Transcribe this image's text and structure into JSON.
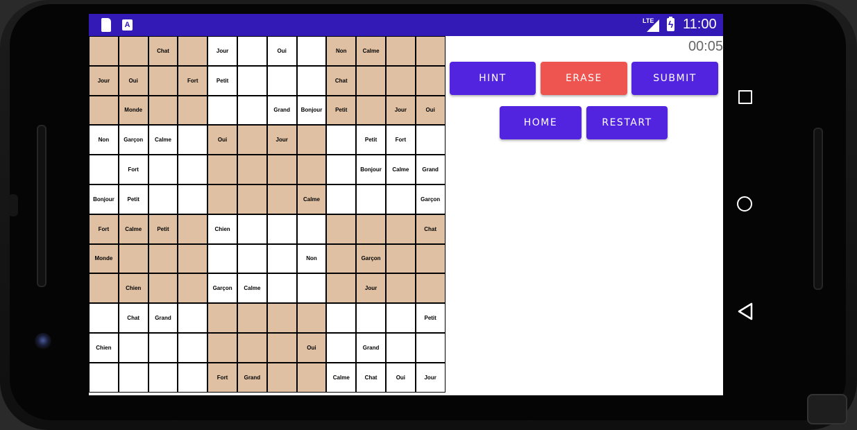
{
  "status_bar": {
    "network": "LTE",
    "time": "11:00",
    "sd_icon": "sd-card-icon",
    "a_icon": "a-icon"
  },
  "timer": "00:05",
  "buttons": {
    "hint": "HINT",
    "erase": "ERASE",
    "submit": "SUBMIT",
    "home": "HOME",
    "restart": "RESTART"
  },
  "colors": {
    "status_bar": "#3319b5",
    "primary_button": "#5224df",
    "erase_button": "#ee5550",
    "shaded_cell": "#dfc0a2"
  },
  "grid": {
    "shading_rule": "3x4 boxes alternate shaded/white",
    "rows": [
      [
        "",
        "",
        "Chat",
        "",
        "Jour",
        "",
        "Oui",
        "",
        "Non",
        "Calme",
        "",
        ""
      ],
      [
        "Jour",
        "Oui",
        "",
        "Fort",
        "Petit",
        "",
        "",
        "",
        "Chat",
        "",
        "",
        ""
      ],
      [
        "",
        "Monde",
        "",
        "",
        "",
        "",
        "Grand",
        "Bonjour",
        "Petit",
        "",
        "Jour",
        "Oui"
      ],
      [
        "Non",
        "Garçon",
        "Calme",
        "",
        "Oui",
        "",
        "Jour",
        "",
        "",
        "Petit",
        "Fort",
        ""
      ],
      [
        "",
        "Fort",
        "",
        "",
        "",
        "",
        "",
        "",
        "",
        "Bonjour",
        "Calme",
        "Grand"
      ],
      [
        "Bonjour",
        "Petit",
        "",
        "",
        "",
        "",
        "",
        "Calme",
        "",
        "",
        "",
        "Garçon"
      ],
      [
        "Fort",
        "Calme",
        "Petit",
        "",
        "Chien",
        "",
        "",
        "",
        "",
        "",
        "",
        "Chat"
      ],
      [
        "Monde",
        "",
        "",
        "",
        "",
        "",
        "",
        "Non",
        "",
        "Garçon",
        "",
        ""
      ],
      [
        "",
        "Chien",
        "",
        "",
        "Garçon",
        "Calme",
        "",
        "",
        "",
        "Jour",
        "",
        ""
      ],
      [
        "",
        "Chat",
        "Grand",
        "",
        "",
        "",
        "",
        "",
        "",
        "",
        "",
        "Petit"
      ],
      [
        "Chien",
        "",
        "",
        "",
        "",
        "",
        "",
        "Oui",
        "",
        "Grand",
        "",
        ""
      ],
      [
        "",
        "",
        "",
        "",
        "Fort",
        "Grand",
        "",
        "",
        "Calme",
        "Chat",
        "Oui",
        "Jour"
      ]
    ]
  },
  "nav_bar": {
    "recents_icon": "square-icon",
    "home_icon": "circle-icon",
    "back_icon": "triangle-back-icon"
  }
}
